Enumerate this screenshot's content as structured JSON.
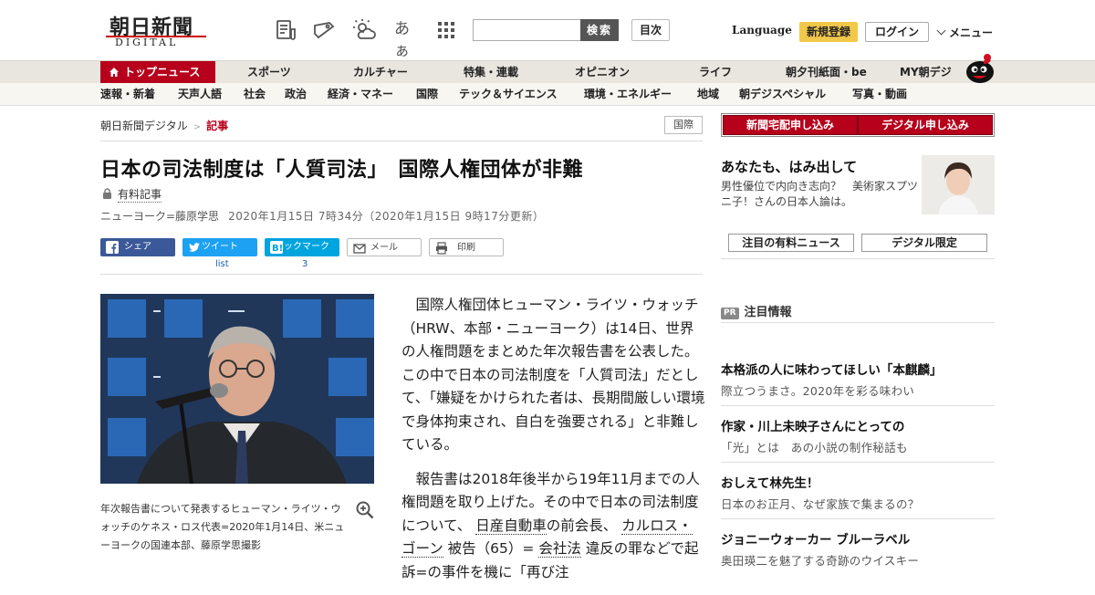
{
  "header": {
    "logo_main": "朝日新聞",
    "logo_sub": "DIGITAL",
    "icons": [
      "newspaper-icon",
      "weather-icon",
      "font-size-icon",
      "apps-grid-icon",
      "bookmark-ticket-icon"
    ],
    "font_size_label": "あぁ",
    "search_placeholder": "",
    "search_button": "検索",
    "toc_button": "目次",
    "language": "Language",
    "register": "新規登録",
    "login": "ログイン",
    "menu": "メニュー"
  },
  "nav_primary": [
    "トップニュース",
    "スポーツ",
    "カルチャー",
    "特集・連載",
    "オピニオン",
    "ライフ",
    "朝夕刊紙面・be",
    "MY朝デジ"
  ],
  "nav_secondary": [
    "速報・新着",
    "天声人語",
    "社会",
    "政治",
    "経済・マネー",
    "国際",
    "テック＆サイエンス",
    "環境・エネルギー",
    "地域",
    "朝デジスペシャル",
    "写真・動画"
  ],
  "breadcrumb": {
    "home": "朝日新聞デジタル",
    "current": "記事"
  },
  "category_tag": "国際",
  "article": {
    "title": "日本の司法制度は「人質司法」　国際人権団体が非難",
    "paid_label": "有料記事",
    "author": "ニューヨーク=藤原学思",
    "date": "2020年1月15日 7時34分（2020年1月15日 9時17分更新）",
    "share": {
      "facebook": "シェア",
      "twitter": "ツイート",
      "twitter_count": "list",
      "hatena": "ブックマーク",
      "hatena_count": "3",
      "mail": "メール",
      "print": "印刷"
    },
    "photo_caption": "年次報告書について発表するヒューマン・ライツ・ウォッチのケネス・ロス代表=2020年1月14日、米ニューヨークの国連本部、藤原学思撮影",
    "p1": "国際人権団体ヒューマン・ライツ・ウォッチ（HRW、本部・ニューヨーク）は14日、世界の人権問題をまとめた年次報告書を公表した。この中で日本の司法制度を「人質司法」だとして、「嫌疑をかけられた者は、長期間厳しい環境で身体拘束され、自白を強要される」と非難している。",
    "p2_a": "報告書は2018年後半から19年11月までの人権問題を取り上げた。その中で日本の司法制度について、",
    "p2_link1": "日産自動車",
    "p2_b": "の前会長、",
    "p2_link2": "カルロス・ゴーン",
    "p2_c": "被告（65）=",
    "p2_link3": "会社法",
    "p2_d": "違反の罪などで起訴=の事件を機に「再び注"
  },
  "sidebar": {
    "btn_delivery": "新聞宅配申し込み",
    "btn_digital": "デジタル申し込み",
    "promo_title": "あなたも、はみ出して",
    "promo_text": "男性優位で内向き志向？　美術家スプツニ子！さんの日本人論は。",
    "tab_paid": "注目の有料ニュース",
    "tab_digital": "デジタル限定",
    "pr_badge": "PR",
    "pr_heading": "注目情報",
    "pr_items": [
      {
        "title": "本格派の人に味わってほしい「本麒麟」",
        "sub": "際立つうまさ。2020年を彩る味わい"
      },
      {
        "title": "作家・川上未映子さんにとっての",
        "sub": "「光」とは　あの小説の制作秘話も"
      },
      {
        "title": "おしえて林先生！",
        "sub": "日本のお正月、なぜ家族で集まるの？"
      },
      {
        "title": "ジョニーウォーカー ブルーラベル",
        "sub": "奥田瑛二を魅了する奇跡のウイスキー"
      }
    ]
  },
  "colors": {
    "brand_red": "#b7001b",
    "register_yellow": "#f2c84b",
    "facebook": "#3b5998",
    "twitter": "#1da1f2",
    "hatena": "#00a4de"
  }
}
